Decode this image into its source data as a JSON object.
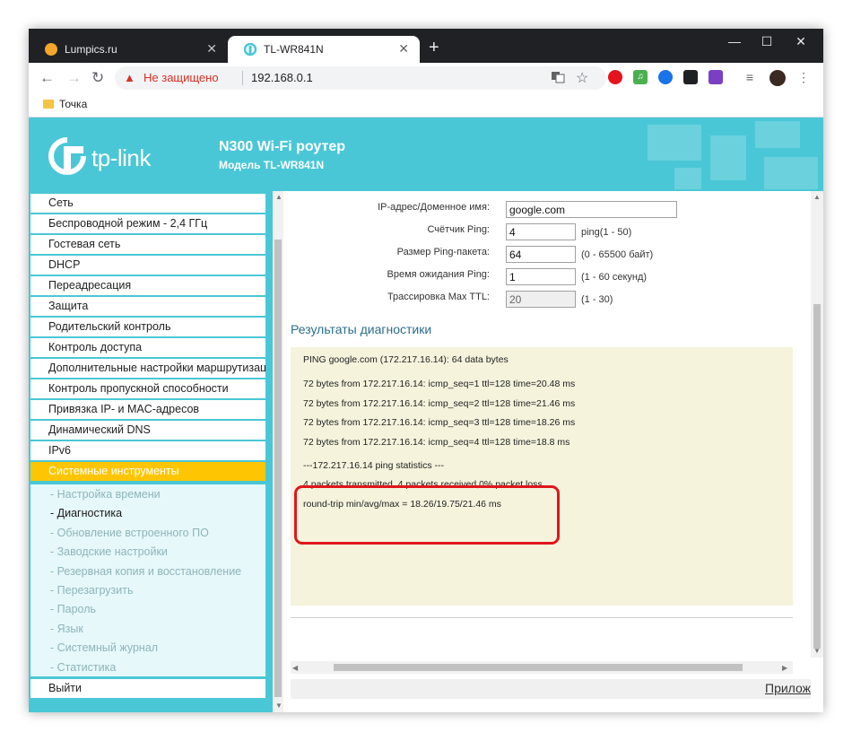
{
  "browser": {
    "tabs": [
      {
        "title": "Lumpics.ru",
        "close": "✕"
      },
      {
        "title": "TL-WR841N",
        "close": "✕"
      }
    ],
    "new_tab": "+",
    "window_controls": {
      "minimize": "—",
      "maximize": "☐",
      "close": "✕"
    },
    "nav": {
      "back": "←",
      "forward": "→",
      "reload": "↻"
    },
    "security_icon": "▲",
    "security_label": "Не защищено",
    "url": "192.168.0.1",
    "bookmarks": [
      {
        "label": "Точка"
      }
    ]
  },
  "router": {
    "logo": "tp-link",
    "model_title": "N300 Wi-Fi роутер",
    "model_subtitle": "Модель TL-WR841N",
    "brand_color": "#4ac7d6",
    "accent_color": "#fec602"
  },
  "sidebar": {
    "items": [
      {
        "label": "Сеть"
      },
      {
        "label": "Беспроводной режим - 2,4 ГГц"
      },
      {
        "label": "Гостевая сеть"
      },
      {
        "label": "DHCP"
      },
      {
        "label": "Переадресация"
      },
      {
        "label": "Защита"
      },
      {
        "label": "Родительский контроль"
      },
      {
        "label": "Контроль доступа"
      },
      {
        "label": "Дополнительные настройки маршрутизации"
      },
      {
        "label": "Контроль пропускной способности"
      },
      {
        "label": "Привязка IP- и MAC-адресов"
      },
      {
        "label": "Динамический DNS"
      },
      {
        "label": "IPv6"
      },
      {
        "label": "Системные инструменты"
      }
    ],
    "subitems": [
      {
        "label": "- Настройка времени"
      },
      {
        "label": "- Диагностика"
      },
      {
        "label": "- Обновление встроенного ПО"
      },
      {
        "label": "- Заводские настройки"
      },
      {
        "label": "- Резервная копия и восстановление"
      },
      {
        "label": "- Перезагрузить"
      },
      {
        "label": "- Пароль"
      },
      {
        "label": "- Язык"
      },
      {
        "label": "- Системный журнал"
      },
      {
        "label": "- Статистика"
      }
    ],
    "logout": "Выйти"
  },
  "form": {
    "ip_label": "IP-адрес/Доменное имя:",
    "ip_value": "google.com",
    "count_label": "Счётчик Ping:",
    "count_value": "4",
    "count_hint": "ping(1 - 50)",
    "size_label": "Размер Ping-пакета:",
    "size_value": "64",
    "size_hint": "(0 - 65500 байт)",
    "timeout_label": "Время ожидания Ping:",
    "timeout_value": "1",
    "timeout_hint": "(1 - 60 секунд)",
    "ttl_label": "Трассировка Max TTL:",
    "ttl_value": "20",
    "ttl_hint": "(1 - 30)"
  },
  "results": {
    "title": "Результаты диагностики",
    "lines": [
      "PING google.com (172.217.16.14): 64 data bytes",
      "72 bytes from 172.217.16.14: icmp_seq=1 ttl=128 time=20.48 ms",
      "72 bytes from 172.217.16.14: icmp_seq=2 ttl=128 time=21.46 ms",
      "72 bytes from 172.217.16.14: icmp_seq=3 ttl=128 time=18.26 ms",
      "72 bytes from 172.217.16.14: icmp_seq=4 ttl=128 time=18.8 ms",
      "---172.217.16.14 ping statistics ---",
      "4 packets transmitted, 4 packets received,0% packet loss",
      "round-trip min/avg/max = 18.26/19.75/21.46 ms"
    ]
  },
  "footer": {
    "link": "Прилож"
  }
}
